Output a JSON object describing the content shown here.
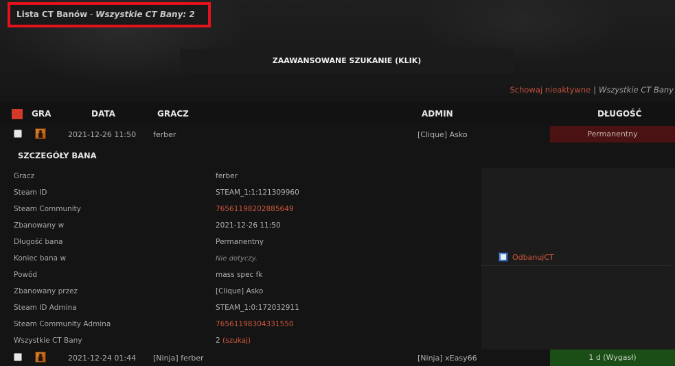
{
  "page": {
    "title_main": "Lista CT Banów",
    "title_sep": " - ",
    "title_count": "Wszystkie CT Bany: 2"
  },
  "toolbar": {
    "advanced_search": "ZAAWANSOWANE SZUKANIE (KLIK)",
    "hide_inactive": "Schowaj nieaktywne",
    "separator": "|",
    "all_bans": "Wszystkie CT Bany"
  },
  "table": {
    "headers": {
      "game": "GRA",
      "date": "DATA",
      "player": "GRACZ",
      "admin": "ADMIN",
      "length": "DŁUGOŚĆ"
    },
    "rows": [
      {
        "date": "2021-12-26 11:50",
        "player": "ferber",
        "admin": "[Clique] Asko",
        "length": "Permanentny",
        "length_color": "#4a1212"
      },
      {
        "date": "2021-12-24 01:44",
        "player": "[Ninja] ferber",
        "admin": "[Ninja] xEasy66",
        "length": "1 d (Wygasł)",
        "length_color": "#1b4d16"
      }
    ]
  },
  "details": {
    "title": "SZCZEGÓŁY BANA",
    "fields": [
      {
        "label": "Gracz",
        "value": "ferber"
      },
      {
        "label": "Steam ID",
        "value": "STEAM_1:1:121309960"
      },
      {
        "label": "Steam Community",
        "value": "76561198202885649"
      },
      {
        "label": "Zbanowany w",
        "value": "2021-12-26 11:50"
      },
      {
        "label": "Długość bana",
        "value": "Permanentny"
      },
      {
        "label": "Koniec bana w",
        "value": "Nie dotyczy."
      },
      {
        "label": "Powód",
        "value": "mass spec fk"
      },
      {
        "label": "Zbanowany przez",
        "value": "[Clique] Asko"
      },
      {
        "label": "Steam ID Admina",
        "value": "STEAM_1:0:172032911"
      },
      {
        "label": "Steam Community Admina",
        "value": "76561198304331550"
      },
      {
        "label": "Wszystkie CT Bany",
        "value": "2",
        "extra": "(szukaj)"
      }
    ],
    "unban_label": "OdbanujCT"
  },
  "colors": {
    "accent_red": "#e3121d",
    "link": "#d0573d",
    "permanent": "#4a1212",
    "expired": "#1b4d16"
  }
}
